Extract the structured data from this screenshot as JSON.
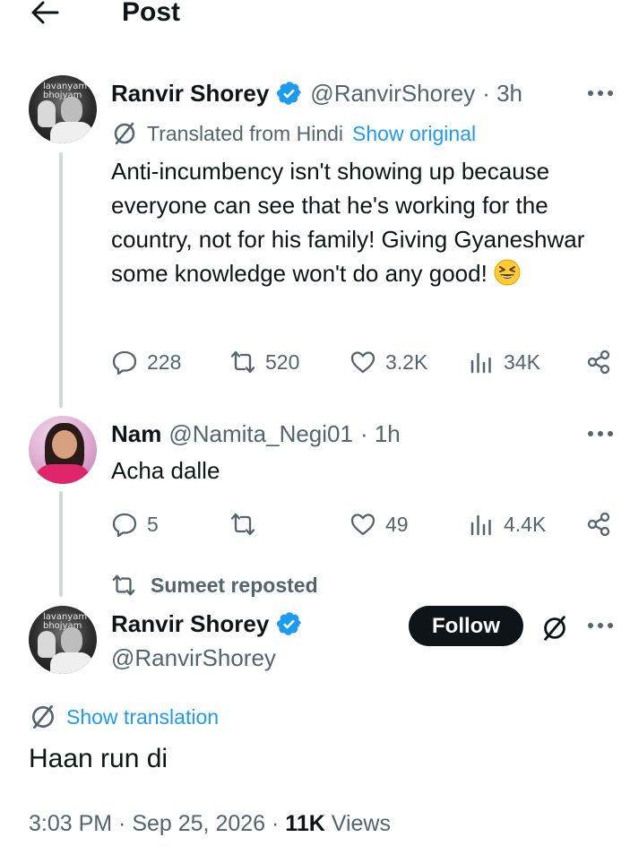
{
  "header": {
    "title": "Post"
  },
  "parent_tweet": {
    "name": "Ranvir Shorey",
    "handle": "@RanvirShorey",
    "time": "· 3h",
    "avatar_text": [
      "lavanyam",
      "bhojyam"
    ],
    "translated_from": "Translated from Hindi",
    "show_original": "Show original",
    "text": "Anti-incumbency isn't showing up because everyone can see that he's working for the country, not for his family! Giving Gyaneshwar some knowledge won't do any good!",
    "emoji": "grinning-squinting-face",
    "stats": {
      "replies": "228",
      "reposts": "520",
      "likes": "3.2K",
      "views": "34K"
    }
  },
  "reply_tweet": {
    "name": "Nam",
    "handle": "@Namita_Negi01",
    "time": "· 1h",
    "text": "Acha dalle",
    "stats": {
      "replies": "5",
      "reposts": "",
      "likes": "49",
      "views": "4.4K"
    }
  },
  "main_tweet": {
    "reposted_by": "Sumeet",
    "reposted_label": "reposted",
    "name": "Ranvir Shorey",
    "handle": "@RanvirShorey",
    "avatar_text": [
      "lavanyam",
      "bhojyam"
    ],
    "follow_label": "Follow",
    "show_translation": "Show translation",
    "text": "Haan run di",
    "timestamp": "3:03 PM · Sep 25, 2026 ·",
    "views_count": "11K",
    "views_label": "Views"
  },
  "colors": {
    "accent": "#1d9bf0",
    "text": "#0f1419",
    "secondary": "#536471",
    "line": "#cfd9de"
  }
}
